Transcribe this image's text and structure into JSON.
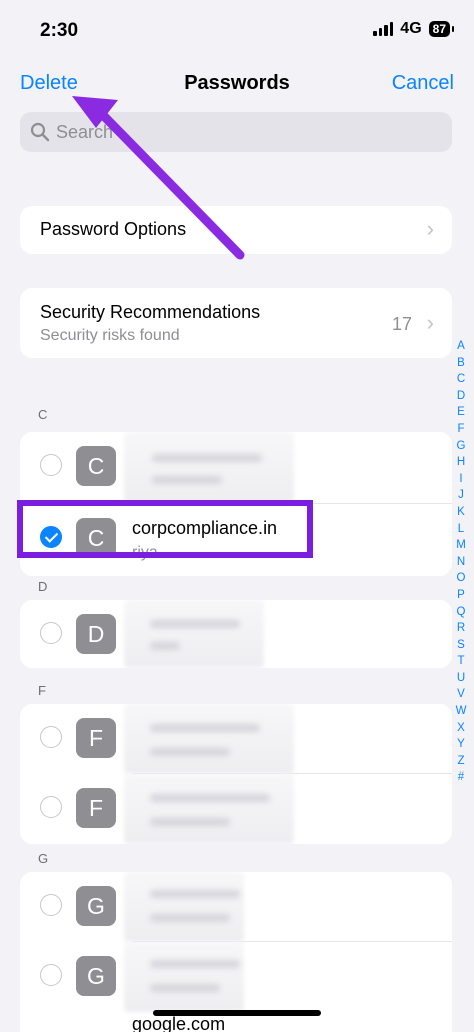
{
  "status_bar": {
    "time": "2:30",
    "network": "4G",
    "battery": "87"
  },
  "nav": {
    "left": "Delete",
    "title": "Passwords",
    "right": "Cancel"
  },
  "search": {
    "placeholder": "Search"
  },
  "options": {
    "label": "Password Options"
  },
  "security": {
    "title": "Security Recommendations",
    "subtitle": "Security risks found",
    "count": "17"
  },
  "sections": [
    {
      "letter": "C",
      "rows": [
        {
          "avatar": "C",
          "checked": false,
          "site": "",
          "user": ""
        },
        {
          "avatar": "C",
          "checked": true,
          "site": "corpcompliance.in",
          "user": "riya"
        }
      ]
    },
    {
      "letter": "D",
      "rows": [
        {
          "avatar": "D",
          "checked": false,
          "site": "",
          "user": ""
        }
      ]
    },
    {
      "letter": "F",
      "rows": [
        {
          "avatar": "F",
          "checked": false,
          "site": "",
          "user": ""
        },
        {
          "avatar": "F",
          "checked": false,
          "site": "",
          "user": ""
        }
      ]
    },
    {
      "letter": "G",
      "rows": [
        {
          "avatar": "G",
          "checked": false,
          "site": "",
          "user": ""
        },
        {
          "avatar": "G",
          "checked": false,
          "site": "",
          "user": ""
        },
        {
          "avatar": "G",
          "checked": false,
          "site": "google.com",
          "user": ""
        }
      ]
    }
  ],
  "index_letters": [
    "A",
    "B",
    "C",
    "D",
    "E",
    "F",
    "G",
    "H",
    "I",
    "J",
    "K",
    "L",
    "M",
    "N",
    "O",
    "P",
    "Q",
    "R",
    "S",
    "T",
    "U",
    "V",
    "W",
    "X",
    "Y",
    "Z",
    "#"
  ],
  "colors": {
    "accent": "#0a84ff",
    "highlight": "#7a1fe0",
    "arrow": "#8a2be2"
  }
}
